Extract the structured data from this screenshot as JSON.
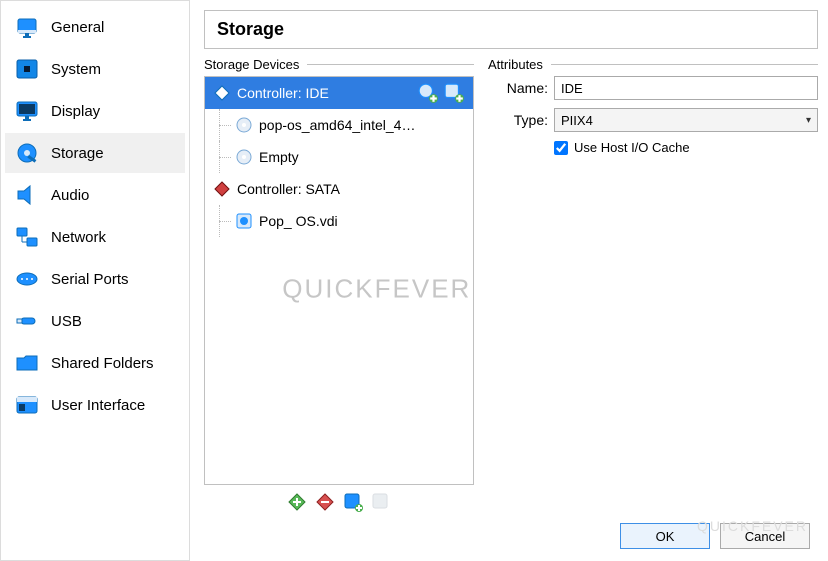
{
  "sidebar": {
    "items": [
      {
        "label": "General"
      },
      {
        "label": "System"
      },
      {
        "label": "Display"
      },
      {
        "label": "Storage"
      },
      {
        "label": "Audio"
      },
      {
        "label": "Network"
      },
      {
        "label": "Serial Ports"
      },
      {
        "label": "USB"
      },
      {
        "label": "Shared Folders"
      },
      {
        "label": "User Interface"
      }
    ],
    "active_index": 3
  },
  "header": {
    "title": "Storage"
  },
  "storage_devices": {
    "label": "Storage Devices",
    "tree": [
      {
        "label": "Controller: IDE",
        "selected": true,
        "children": [
          {
            "label": "pop-os_amd64_intel_4…"
          },
          {
            "label": "Empty"
          }
        ]
      },
      {
        "label": "Controller: SATA",
        "children": [
          {
            "label": "Pop_ OS.vdi"
          }
        ]
      }
    ]
  },
  "attributes": {
    "label": "Attributes",
    "name_label": "Name:",
    "name_value": "IDE",
    "type_label": "Type:",
    "type_value": "PIIX4",
    "host_io_label": "Use Host I/O Cache",
    "host_io_checked": true
  },
  "footer": {
    "ok": "OK",
    "cancel": "Cancel"
  },
  "watermark": "QUICKFEVER"
}
